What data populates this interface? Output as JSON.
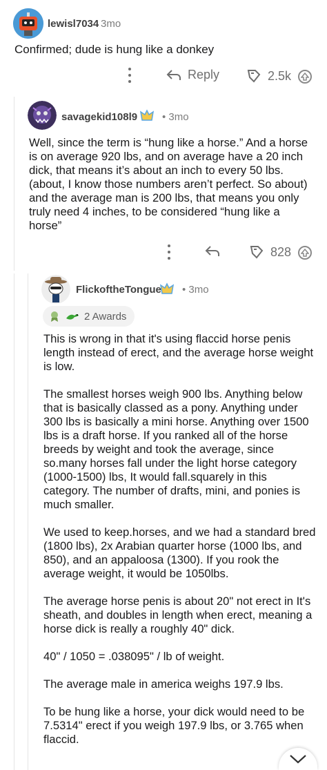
{
  "comment1": {
    "username": "lewisl7034",
    "age": "3mo",
    "text": "Confirmed; dude is hung like a donkey",
    "reply_label": "Reply",
    "vote_count": "2.5k"
  },
  "comment2": {
    "username": "savagekid108l9",
    "age": "• 3mo",
    "text": "Well, since the term is “hung like a horse.” And a horse is on average 920 lbs, and on average have a 20 inch dick, that means it’s about an inch to every 50 lbs. (about, I know those numbers aren’t perfect. So about) and the average man is 200 lbs, that means you only truly need 4 inches, to be considered “hung like a horse”",
    "vote_count": "828"
  },
  "comment3": {
    "username": "FlickoftheTongue",
    "age": "• 3mo",
    "awards_label": "2 Awards",
    "paragraphs": [
      "This is wrong in that it's using flaccid horse penis length instead of erect, and the average horse weight is low.",
      "The smallest horses weigh 900 lbs. Anything below that is basically classed as a pony. Anything under 300 lbs is basically a mini horse. Anything over 1500 lbs is a draft horse. If you ranked all of the horse breeds by weight and took the average, since so.many horses fall under the light horse category (1000-1500) lbs, It would fall.squarely in this category. The number of drafts, mini, and ponies is much smaller.",
      "We used to keep.horses, and we had a standard bred (1800 lbs), 2x Arabian quarter horse (1000 lbs, and 850), and an appaloosa (1300). If you rook the average weight, it would be 1050lbs.",
      "The average horse penis is about 20\" not erect in It's sheath, and doubles in length when erect, meaning a horse dick is really a roughly 40\" dick.",
      "40\" / 1050 = .038095\" / lb of weight.",
      "The average male in america weighs 197.9 lbs.",
      "To be hung like a horse,  your dick would need to be 7.5314\" erect if you weigh 197.9 lbs, or 3.765 when flaccid."
    ]
  },
  "icons": {
    "more": "more-options-icon",
    "reply": "reply-arrow-icon",
    "award": "award-icon",
    "upvote": "upvote-icon",
    "expand": "chevron-down-icon"
  },
  "colors": {
    "text": "#1a1a1b",
    "muted": "#7c7c7c",
    "icon": "#6f6f6f",
    "thread_line": "#e4e4e4"
  }
}
